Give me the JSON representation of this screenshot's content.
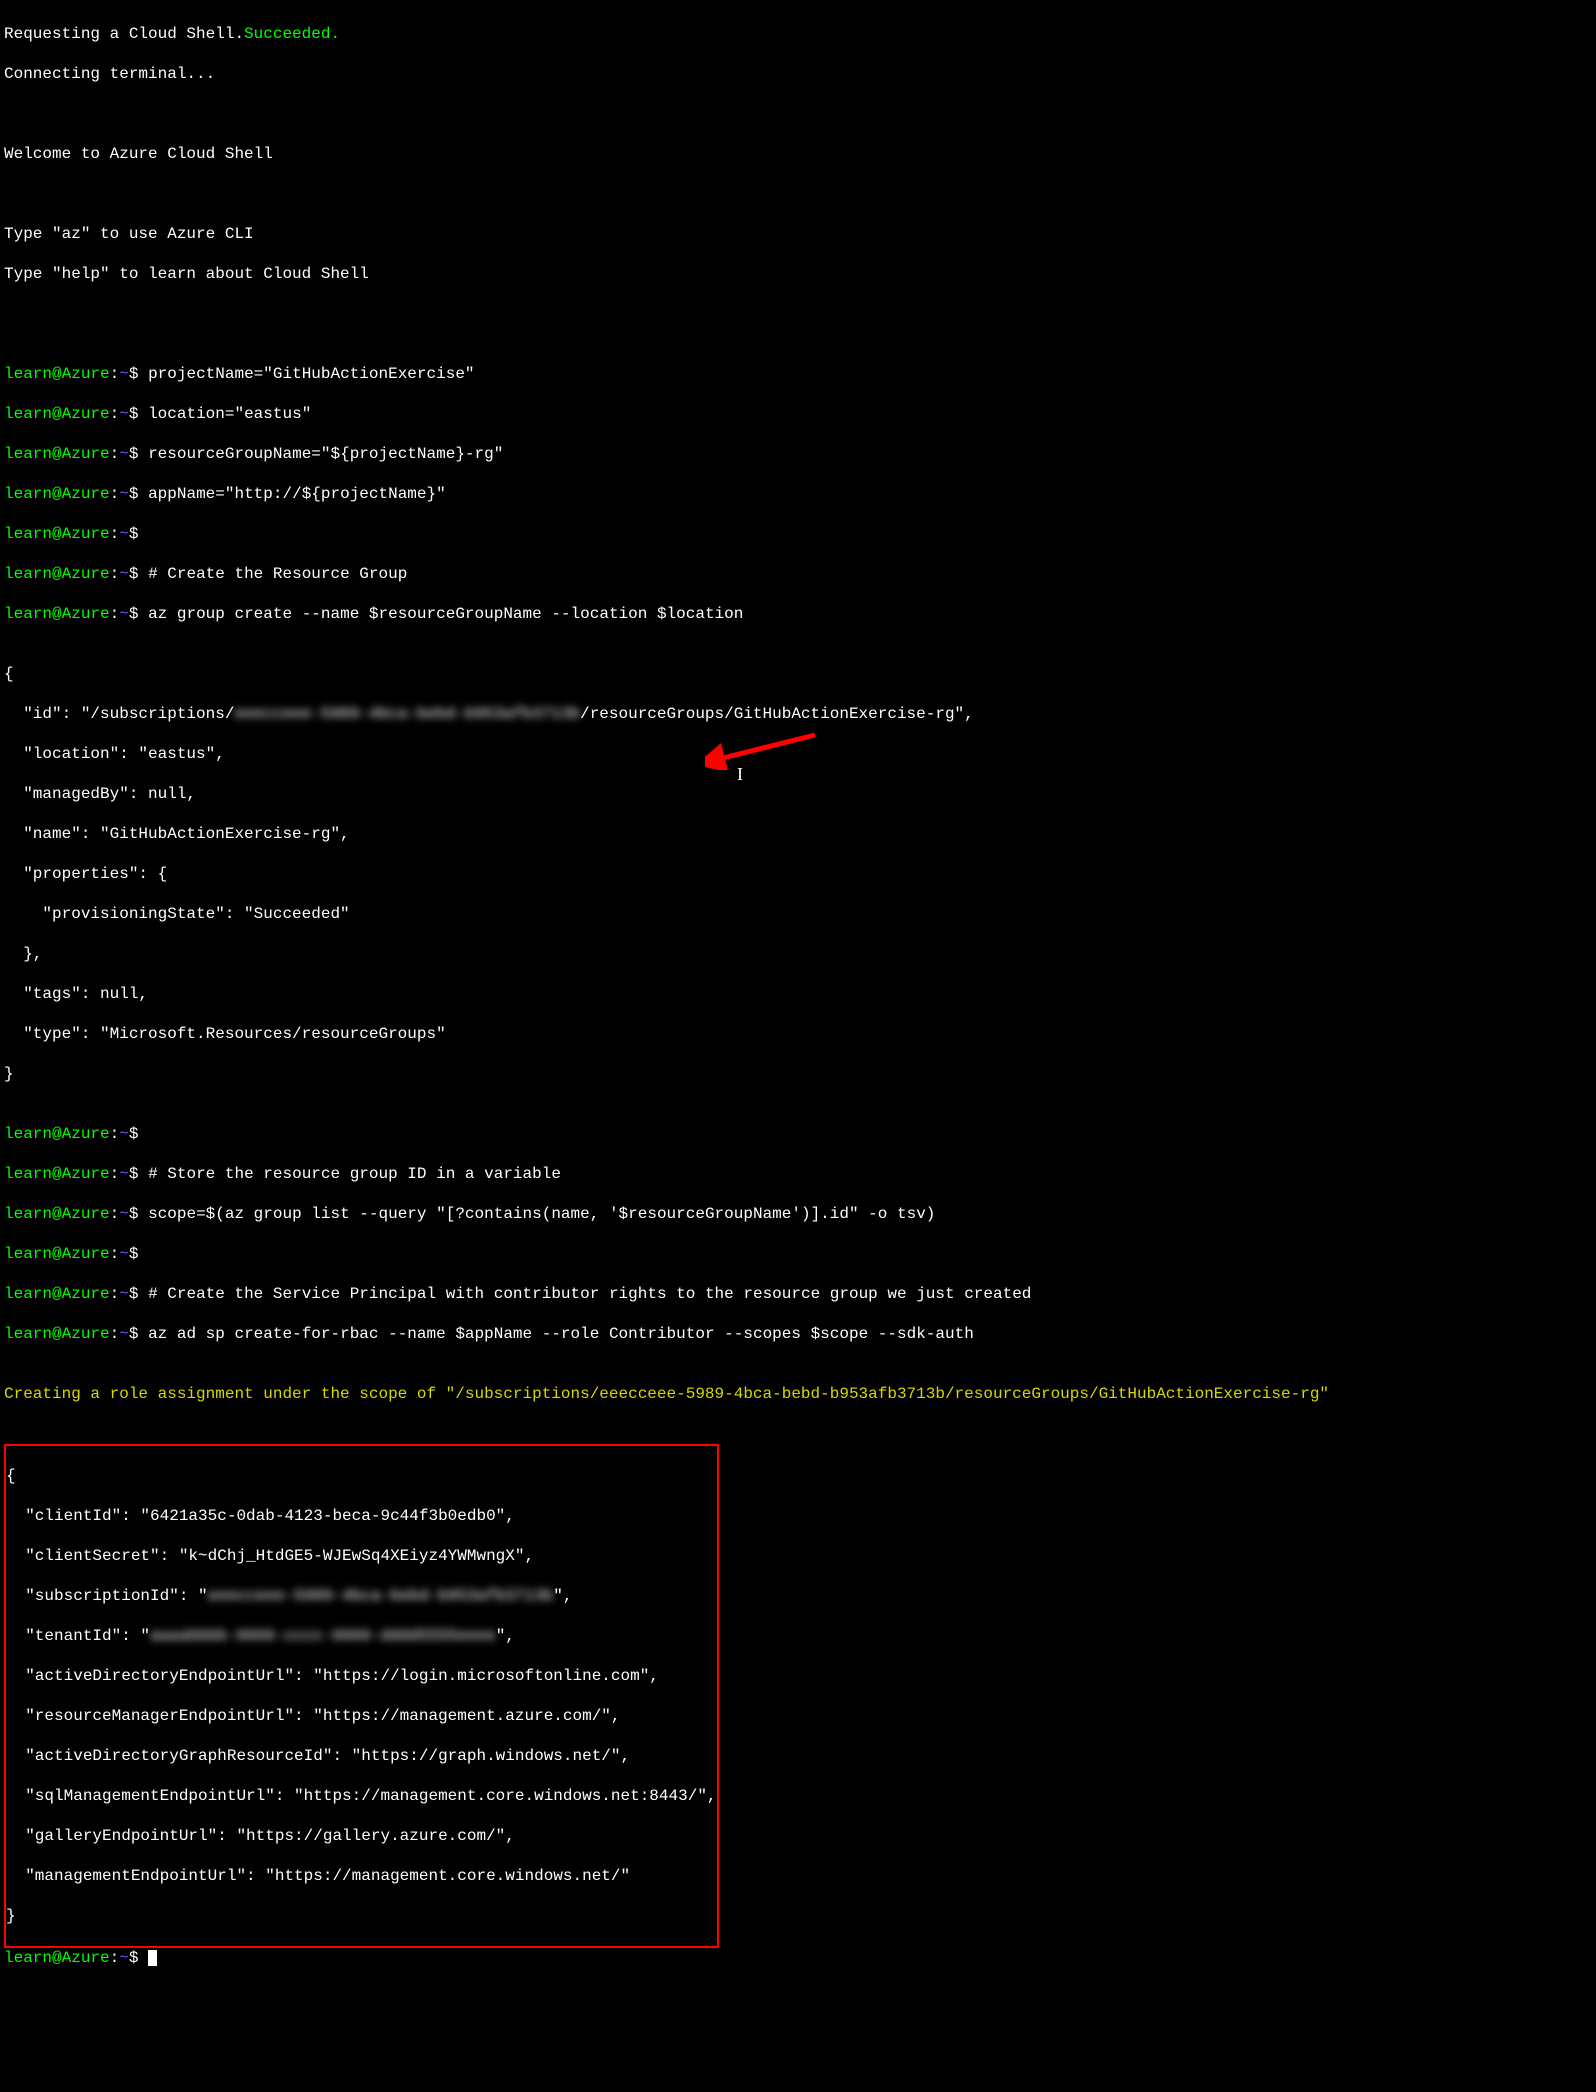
{
  "intro": {
    "requesting": "Requesting a Cloud Shell.",
    "succeeded": "Succeeded.",
    "connecting": "Connecting terminal...",
    "welcome": "Welcome to Azure Cloud Shell",
    "useaz": "Type \"az\" to use Azure CLI",
    "usehelp": "Type \"help\" to learn about Cloud Shell"
  },
  "prompt": {
    "user": "learn@Azure",
    "colon": ":",
    "path": "~",
    "dollar": "$"
  },
  "cmds": {
    "c1": "projectName=\"GitHubActionExercise\"",
    "c2": "location=\"eastus\"",
    "c3": "resourceGroupName=\"${projectName}-rg\"",
    "c4": "appName=\"http://${projectName}\"",
    "c5": "",
    "c6": "# Create the Resource Group",
    "c7": "az group create --name $resourceGroupName --location $location",
    "c8": "",
    "c9": "# Store the resource group ID in a variable",
    "c10": "scope=$(az group list --query \"[?contains(name, '$resourceGroupName')].id\" -o tsv)",
    "c11": "",
    "c12": "# Create the Service Principal with contributor rights to the resource group we just created",
    "c13": "az ad sp create-for-rbac --name $appName --role Contributor --scopes $scope --sdk-auth"
  },
  "group_output": {
    "open": "{",
    "id_pre": "  \"id\": \"/subscriptions/",
    "id_blur": "eeecceee-5989-4bca-bebd-b953afb3713b",
    "id_post": "/resourceGroups/GitHubActionExercise-rg\",",
    "location": "  \"location\": \"eastus\",",
    "managedBy": "  \"managedBy\": null,",
    "name": "  \"name\": \"GitHubActionExercise-rg\",",
    "props_open": "  \"properties\": {",
    "prov": "    \"provisioningState\": \"Succeeded\"",
    "props_close": "  },",
    "tags": "  \"tags\": null,",
    "type": "  \"type\": \"Microsoft.Resources/resourceGroups\"",
    "close": "}"
  },
  "role_msg": "Creating a role assignment under the scope of \"/subscriptions/eeecceee-5989-4bca-bebd-b953afb3713b/resourceGroups/GitHubActionExercise-rg\"",
  "sp_output": {
    "open": "{",
    "clientId": "  \"clientId\": \"6421a35c-0dab-4123-beca-9c44f3b0edb0\",",
    "clientSecret": "  \"clientSecret\": \"k~dChj_HtdGE5-WJEwSq4XEiyz4YWMwngX\",",
    "sub_pre": "  \"subscriptionId\": \"",
    "sub_blur": "eeecceee-5989-4bca-bebd-b953afb3713b",
    "sub_post": "\",",
    "ten_pre": "  \"tenantId\": \"",
    "ten_blur": "aaaabbbb-6666-cccc-6666-dddd5555eeee",
    "ten_post": "\",",
    "adUrl": "  \"activeDirectoryEndpointUrl\": \"https://login.microsoftonline.com\",",
    "rmUrl": "  \"resourceManagerEndpointUrl\": \"https://management.azure.com/\",",
    "graphId": "  \"activeDirectoryGraphResourceId\": \"https://graph.windows.net/\",",
    "sqlUrl": "  \"sqlManagementEndpointUrl\": \"https://management.core.windows.net:8443/\",",
    "galleryUrl": "  \"galleryEndpointUrl\": \"https://gallery.azure.com/\",",
    "mgmtUrl": "  \"managementEndpointUrl\": \"https://management.core.windows.net/\"",
    "close": "}"
  }
}
